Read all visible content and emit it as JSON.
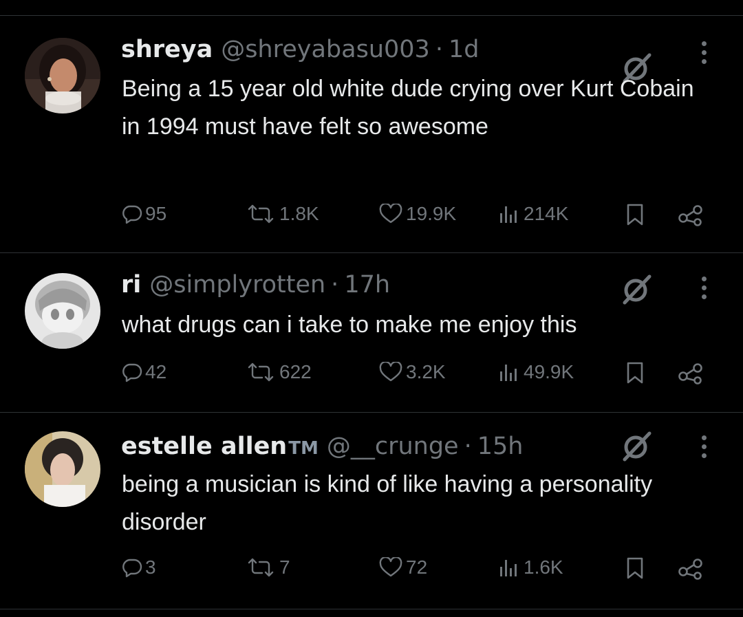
{
  "tweets": [
    {
      "name": "shreya",
      "badge": "",
      "handle": "@shreyabasu003",
      "separator": "·",
      "time": "1d",
      "text": "Being a 15 year old white dude crying over Kurt Cobain in 1994 must have felt so awesome",
      "replies": "95",
      "reposts": "1.8K",
      "likes": "19.9K",
      "views": "214K"
    },
    {
      "name": "ri",
      "badge": "",
      "handle": "@simplyrotten",
      "separator": "·",
      "time": "17h",
      "text": "what drugs can i take to make me enjoy this",
      "replies": "42",
      "reposts": "622",
      "likes": "3.2K",
      "views": "49.9K"
    },
    {
      "name": "estelle allen",
      "badge": "TM",
      "handle": "@__crunge",
      "separator": "·",
      "time": "15h",
      "text": "being a musician is kind of like having a personality disorder",
      "replies": "3",
      "reposts": "7",
      "likes": "72",
      "views": "1.6K"
    }
  ],
  "icons": {
    "reply": "reply-icon",
    "repost": "repost-icon",
    "like": "like-icon",
    "views": "views-icon",
    "bookmark": "bookmark-icon",
    "share": "share-icon",
    "grok": "grok-icon",
    "more": "more-options-icon"
  },
  "colors": {
    "background": "#000000",
    "text": "#e7e9ea",
    "secondary": "#71767b",
    "divider": "#2f3336"
  }
}
